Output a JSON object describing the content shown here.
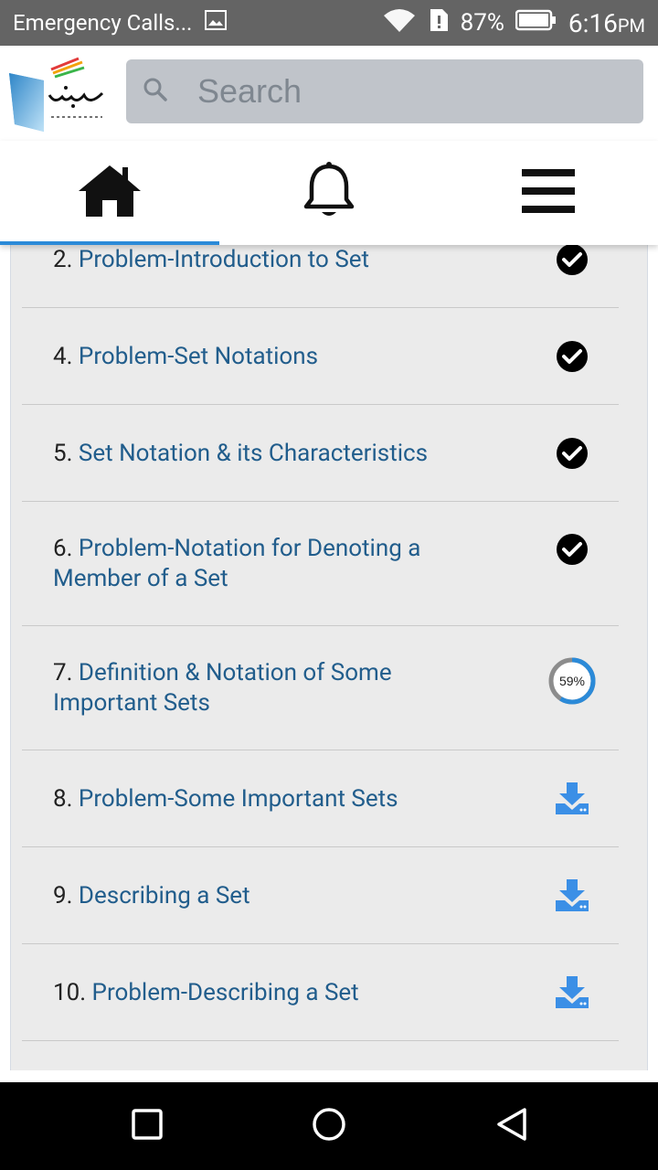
{
  "status_bar": {
    "notification_text": "Emergency Calls...",
    "battery_percent": "87%",
    "time": "6:16",
    "time_suffix": "PM"
  },
  "header": {
    "logo_name": "sabaq-logo",
    "search_placeholder": "Search"
  },
  "nav": {
    "active_tab": "home"
  },
  "lessons": [
    {
      "number": "2.",
      "title": "Problem-Introduction to Set",
      "status": "completed"
    },
    {
      "number": "4.",
      "title": "Problem-Set Notations",
      "status": "completed"
    },
    {
      "number": "5.",
      "title": "Set Notation & its Characteristics",
      "status": "completed"
    },
    {
      "number": "6.",
      "title": "Problem-Notation for Denoting a Member of a Set",
      "status": "completed"
    },
    {
      "number": "7.",
      "title": "Definition & Notation of Some Important Sets",
      "status": "in-progress",
      "progress": "59%"
    },
    {
      "number": "8.",
      "title": "Problem-Some Important Sets",
      "status": "download"
    },
    {
      "number": "9.",
      "title": "Describing a Set",
      "status": "download"
    },
    {
      "number": "10.",
      "title": "Problem-Describing a Set",
      "status": "download"
    }
  ],
  "colors": {
    "status_bar_bg": "#646464",
    "link_blue": "#215d8c",
    "accent_blue": "#2b8ad8",
    "download_blue": "#3b8fe6",
    "list_bg": "#ebebeb"
  }
}
